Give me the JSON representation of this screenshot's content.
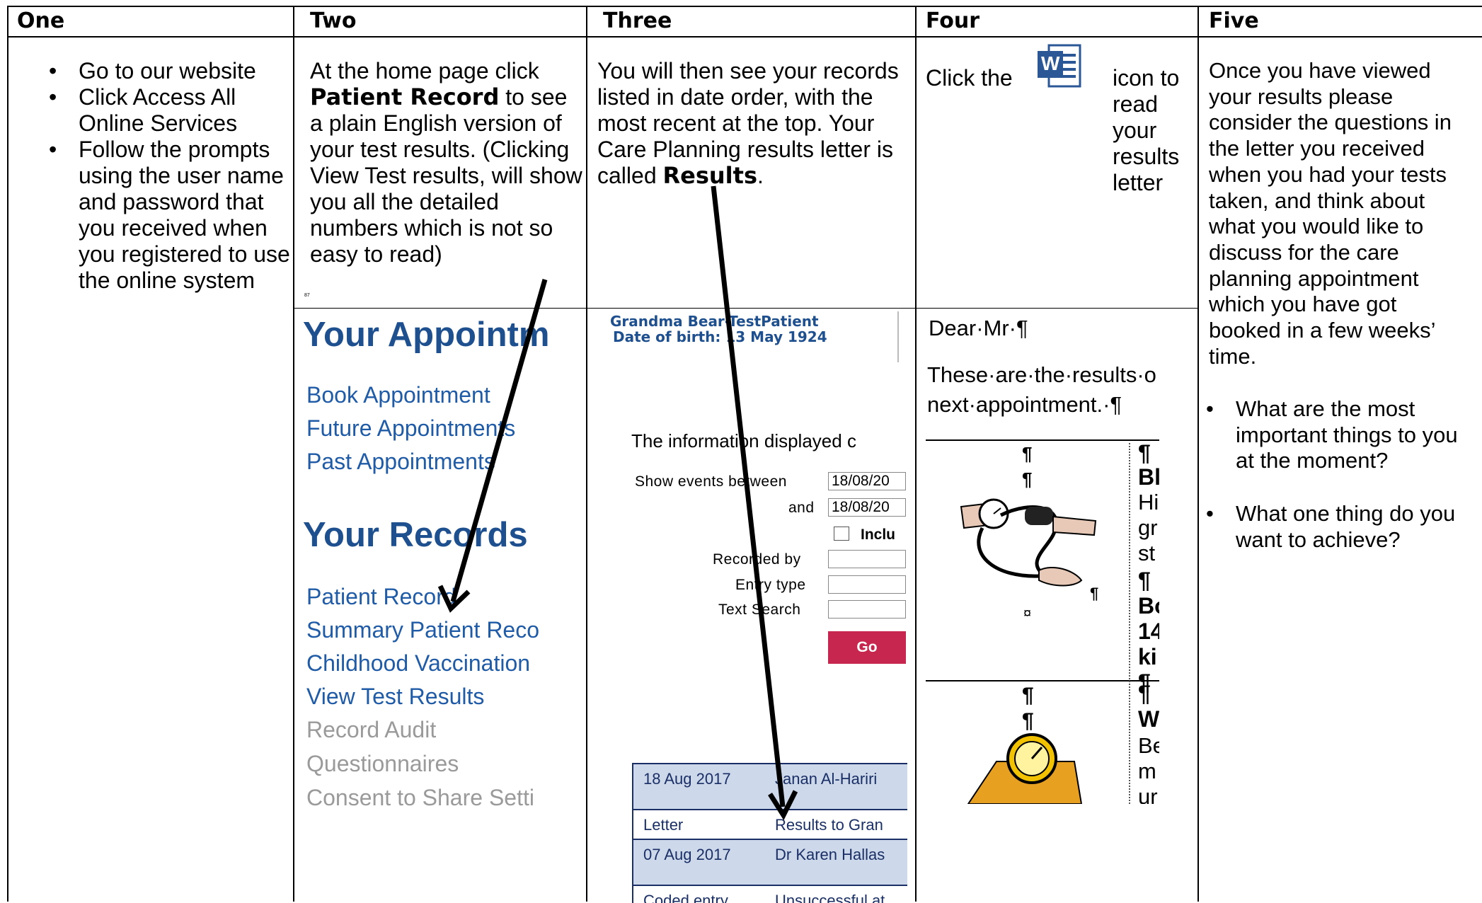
{
  "headers": [
    "One",
    "Two",
    "Three",
    "Four",
    "Five"
  ],
  "col1": {
    "bullets": [
      "Go to our website",
      "Click Access All Online Services",
      "Follow the prompts using the user name and password that you received when you registered to use the online system"
    ]
  },
  "col2": {
    "text_pre": "At the home page click ",
    "text_bold": "Patient Record",
    "text_post": " to see a plain English version of your test results. (Clicking View Test results, will show you all the detailed numbers which is not so easy to read)",
    "tiny_mark": "87",
    "panel": {
      "appointments_heading": "Your Appointm",
      "appointment_links": [
        "Book Appointment",
        "Future Appointments",
        "Past Appointments"
      ],
      "records_heading": "Your Records",
      "record_links": [
        "Patient Record",
        "Summary Patient Reco",
        "Childhood Vaccination",
        "View Test Results"
      ],
      "disabled_links": [
        "Record Audit",
        "Questionnaires",
        "Consent to Share Setti"
      ]
    }
  },
  "col3": {
    "text_pre": "You will then see your records listed in date order, with the most recent at the top. Your Care Planning results letter is called ",
    "text_bold": "Results",
    "text_post": ".",
    "panel": {
      "patient_name": "Grandma Bear-TestPatient",
      "dob": "Date of birth: 13 May 1924",
      "info_text": "The information displayed c",
      "show_between_label": "Show events between",
      "date_from": "18/08/20",
      "and_label": "and",
      "date_to": "18/08/20",
      "include_label": "Inclu",
      "recorded_by_label": "Recorded by",
      "entry_type_label": "Entry type",
      "text_search_label": "Text Search",
      "go_label": "Go",
      "records": [
        {
          "date": "18 Aug 2017",
          "who": "Janan Al-Hariri"
        },
        {
          "type": "Letter",
          "desc": "Results to Gran"
        },
        {
          "date": "07 Aug 2017",
          "who": "Dr Karen Hallas"
        },
        {
          "type": "Coded entry",
          "desc": "Unsuccessful at"
        }
      ]
    }
  },
  "col4": {
    "text_pre": "Click the",
    "text_post": "icon to read your results letter",
    "word_icon_letter": "W",
    "letter": {
      "greeting": "Dear·Mr·¶",
      "line1": "These·are·the·results·o",
      "line2": "next·appointment.·¶",
      "pilcrow": "¶",
      "cell_mark": "¤",
      "right_fragments_1": [
        "¶",
        "Bl",
        "Hi",
        "gr",
        "st",
        "¶",
        "Bo",
        "14",
        "ki",
        "¶"
      ],
      "right_fragments_2": [
        "¶",
        "W",
        "Be",
        "m",
        "ur"
      ]
    }
  },
  "col5": {
    "text": "Once you have viewed your results please consider the questions in the letter you received when you had your tests taken, and think about what you would like to discuss for the care planning appointment which you have got booked in a few weeks’ time.",
    "questions": [
      "What are the most important things to you at the moment?",
      "What one thing do you want to achieve?"
    ]
  }
}
